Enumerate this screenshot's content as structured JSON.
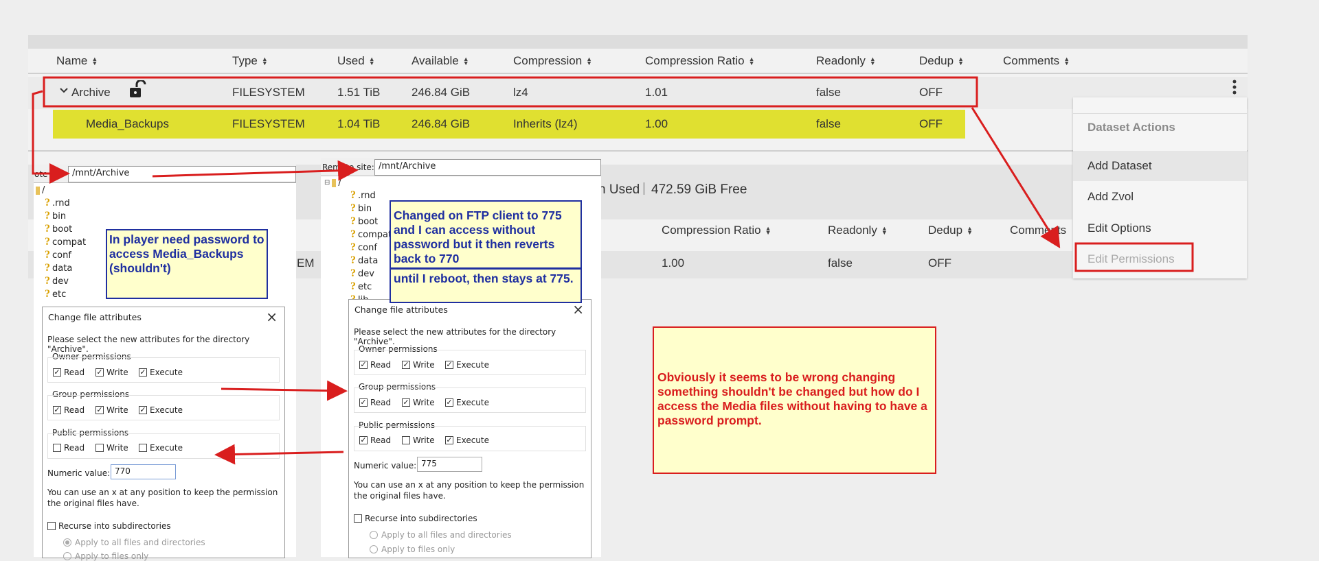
{
  "table": {
    "headers": [
      "Name",
      "Type",
      "Used",
      "Available",
      "Compression",
      "Compression Ratio",
      "Readonly",
      "Dedup",
      "Comments"
    ],
    "rows": [
      {
        "name": "Archive",
        "type": "FILESYSTEM",
        "used": "1.51 TiB",
        "available": "246.84 GiB",
        "compression": "lz4",
        "ratio": "1.01",
        "readonly": "false",
        "dedup": "OFF"
      },
      {
        "name": "Media_Backups",
        "type": "FILESYSTEM",
        "used": "1.04 TiB",
        "available": "246.84 GiB",
        "compression": "Inherits (lz4)",
        "ratio": "1.00",
        "readonly": "false",
        "dedup": "OFF"
      }
    ],
    "pool_summary": {
      "used": "n Used",
      "free": "472.59 GiB Free"
    },
    "second_headers": [
      "Compression Ratio",
      "Readonly",
      "Dedup",
      "Comments"
    ],
    "second_row": {
      "type_tail": "EM",
      "ratio": "1.00",
      "readonly": "false",
      "dedup": "OFF"
    }
  },
  "menu": {
    "title": "Dataset Actions",
    "items": [
      "Add Dataset",
      "Add Zvol",
      "Edit Options",
      "Edit Permissions"
    ]
  },
  "left_ftp": {
    "site_label": "ote",
    "path": "/mnt/Archive",
    "root": "/",
    "items": [
      ".rnd",
      "bin",
      "boot",
      "compat",
      "conf",
      "data",
      "dev",
      "etc"
    ]
  },
  "right_ftp": {
    "site_label": "Remote site:",
    "path": "/mnt/Archive",
    "root": "/",
    "items": [
      ".rnd",
      "bin",
      "boot",
      "compat",
      "conf",
      "data",
      "dev",
      "etc",
      "lib"
    ]
  },
  "left_dialog": {
    "title": "Change file attributes",
    "prompt": "Please select the new attributes for the directory \"Archive\".",
    "groups": [
      {
        "label": "Owner permissions",
        "read": "Read",
        "write": "Write",
        "execute": "Execute"
      },
      {
        "label": "Group permissions",
        "read": "Read",
        "write": "Write",
        "execute": "Execute"
      },
      {
        "label": "Public permissions",
        "read": "Read",
        "write": "Write",
        "execute": "Execute"
      }
    ],
    "numeric_label": "Numeric value:",
    "numeric_value": "770",
    "hint": "You can use an x at any position to keep the permission the original files have.",
    "recurse": "Recurse into subdirectories",
    "apply_all": "Apply to all files and directories",
    "apply_files": "Apply to files only"
  },
  "right_dialog": {
    "title": "Change file attributes",
    "prompt": "Please select the new attributes for the directory \"Archive\".",
    "groups": [
      {
        "label": "Owner permissions",
        "read": "Read",
        "write": "Write",
        "execute": "Execute"
      },
      {
        "label": "Group permissions",
        "read": "Read",
        "write": "Write",
        "execute": "Execute"
      },
      {
        "label": "Public permissions",
        "read": "Read",
        "write": "Write",
        "execute": "Execute"
      }
    ],
    "numeric_label": "Numeric value:",
    "numeric_value": "775",
    "hint": "You can use an x at any position to keep the permission the original files have.",
    "recurse": "Recurse into subdirectories",
    "apply_all": "Apply to all files and directories",
    "apply_files": "Apply to files only"
  },
  "notes": {
    "player": "In player need password to access Media_Backups (shouldn't)",
    "ftp_changed": "Changed on FTP client to 775 and I can access without password but it then reverts back to 770",
    "reboot": "until I reboot, then stays at 775.",
    "question": "Obviously it seems to be wrong changing something shouldn't be changed but how do I access the Media files without having to have a password prompt."
  },
  "colors": {
    "highlight": "#e0e030",
    "annotation_red": "#d91e1e",
    "annotation_blue": "#1f2fa0",
    "note_bg": "#ffffcc"
  }
}
